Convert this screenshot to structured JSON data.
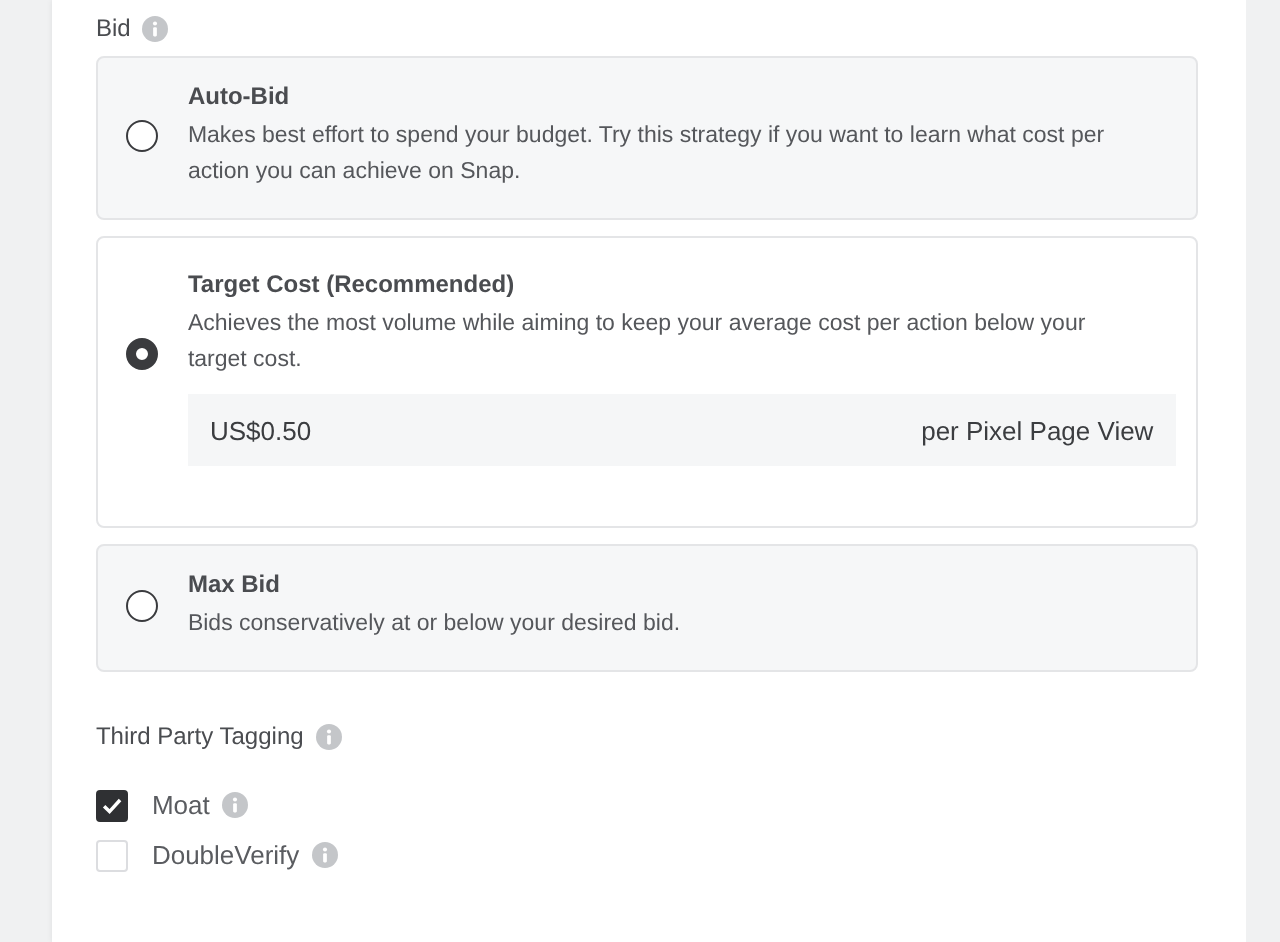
{
  "bid": {
    "label": "Bid",
    "options": [
      {
        "title": "Auto-Bid",
        "description": "Makes best effort to spend your budget. Try this strategy if you want to learn what cost per action you can achieve on Snap.",
        "selected": false
      },
      {
        "title": "Target Cost (Recommended)",
        "description": "Achieves the most volume while aiming to keep your average cost per action below your target cost.",
        "selected": true,
        "amount": "US$0.50",
        "unit": "per Pixel Page View"
      },
      {
        "title": "Max Bid",
        "description": "Bids conservatively at or below your desired bid.",
        "selected": false
      }
    ]
  },
  "third_party_tagging": {
    "label": "Third Party Tagging",
    "options": [
      {
        "label": "Moat",
        "checked": true
      },
      {
        "label": "DoubleVerify",
        "checked": false
      }
    ]
  }
}
